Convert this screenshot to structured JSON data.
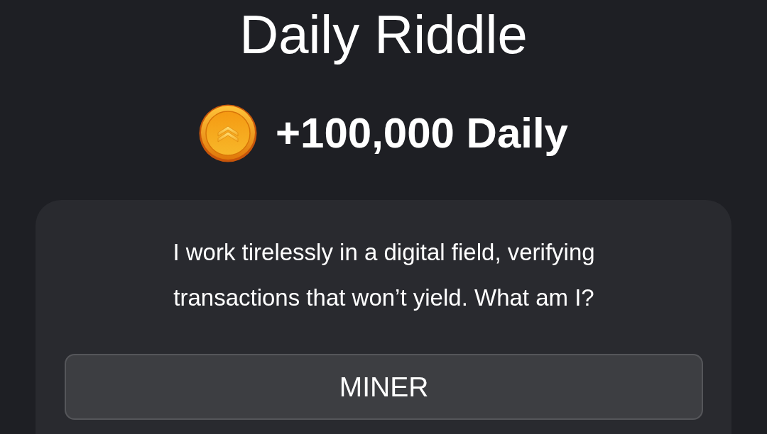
{
  "title": "Daily Riddle",
  "reward": {
    "amount": "+100,000 Daily"
  },
  "riddle": {
    "question": "I work tirelessly in a digital field, verifying transactions that won’t yield. What am I?",
    "answer": {
      "value": "MINER"
    }
  }
}
